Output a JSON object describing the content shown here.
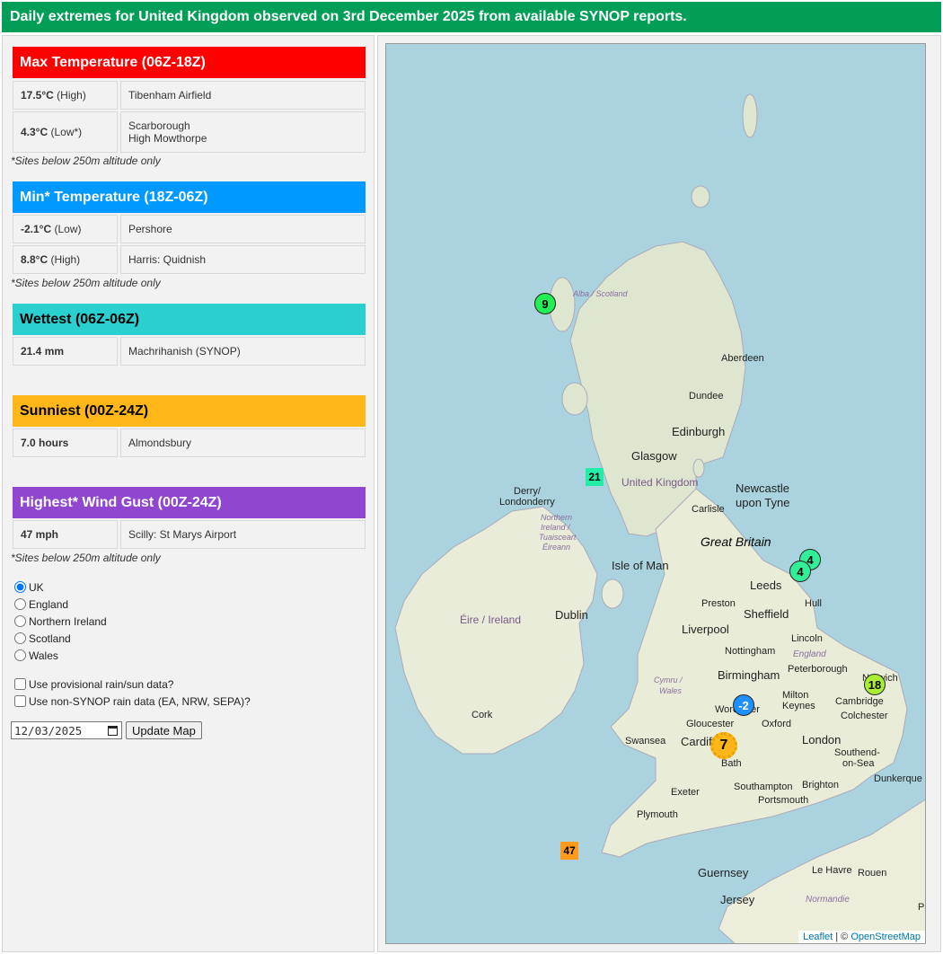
{
  "header": {
    "title": "Daily extremes for United Kingdom observed on 3rd December 2025 from available SYNOP reports."
  },
  "sections": {
    "max_temp": {
      "title": "Max Temperature (06Z-18Z)",
      "color": "#ff0000",
      "rows": [
        {
          "value": "17.5°C",
          "qual": "(High)",
          "site": "Tibenham Airfield"
        },
        {
          "value": "4.3°C",
          "qual": "(Low*)",
          "site": "Scarborough",
          "site2": "High Mowthorpe"
        }
      ],
      "note": "*Sites below 250m altitude only"
    },
    "min_temp": {
      "title": "Min* Temperature (18Z-06Z)",
      "color": "#0099ff",
      "rows": [
        {
          "value": "-2.1°C",
          "qual": "(Low)",
          "site": "Pershore"
        },
        {
          "value": "8.8°C",
          "qual": "(High)",
          "site": "Harris: Quidnish"
        }
      ],
      "note": "*Sites below 250m altitude only"
    },
    "wettest": {
      "title": "Wettest (06Z-06Z)",
      "color": "#2acfcf",
      "rows": [
        {
          "value": "21.4 mm",
          "site": "Machrihanish (SYNOP)"
        }
      ]
    },
    "sunniest": {
      "title": "Sunniest (00Z-24Z)",
      "color": "#ffb619",
      "rows": [
        {
          "value": "7.0 hours",
          "site": "Almondsbury"
        }
      ]
    },
    "gust": {
      "title": "Highest* Wind Gust (00Z-24Z)",
      "color": "#9046cf",
      "rows": [
        {
          "value": "47 mph",
          "site": "Scilly: St Marys Airport"
        }
      ],
      "note": "*Sites below 250m altitude only"
    }
  },
  "regions": [
    "UK",
    "England",
    "Northern Ireland",
    "Scotland",
    "Wales"
  ],
  "selected_region": "UK",
  "options": {
    "provisional": "Use provisional rain/sun data?",
    "non_synop": "Use non-SYNOP rain data (EA, NRW, SEPA)?"
  },
  "date_value": "12/03/2025",
  "update_button": "Update Map",
  "map": {
    "labels": {
      "alba": "Alba / Scotland",
      "aberdeen": "Aberdeen",
      "dundee": "Dundee",
      "edinburgh": "Edinburgh",
      "glasgow": "Glasgow",
      "uk": "United Kingdom",
      "newcastle1": "Newcastle",
      "newcastle2": "upon Tyne",
      "derry1": "Derry/",
      "derry2": "Londonderry",
      "ni1": "Northern",
      "ni2": "Ireland /",
      "ni3": "Tuaisceart",
      "ni4": "Éireann",
      "carlisle": "Carlisle",
      "gb": "Great Britain",
      "iom": "Isle of Man",
      "leeds": "Leeds",
      "preston": "Preston",
      "hull": "Hull",
      "sheffield": "Sheffield",
      "eire": "Éire / Ireland",
      "dublin": "Dublin",
      "liverpool": "Liverpool",
      "lincoln": "Lincoln",
      "nottingham": "Nottingham",
      "england": "England",
      "peterborough": "Peterborough",
      "cymru1": "Cymru /",
      "cymru2": "Wales",
      "birmingham": "Birmingham",
      "norwich": "Norwich",
      "cambridge": "Cambridge",
      "milton1": "Milton",
      "milton2": "Keynes",
      "cork": "Cork",
      "worcester": "Worcester",
      "colchester": "Colchester",
      "gloucester": "Gloucester",
      "oxford": "Oxford",
      "swansea": "Swansea",
      "cardiff": "Cardiff",
      "london": "London",
      "bath": "Bath",
      "southend1": "Southend-",
      "southend2": "on-Sea",
      "dunkerque": "Dunkerque",
      "exeter": "Exeter",
      "southampton": "Southampton",
      "brighton": "Brighton",
      "portsmouth": "Portsmouth",
      "plymouth": "Plymouth",
      "guernsey": "Guernsey",
      "lehavre": "Le Havre",
      "rouen": "Rouen",
      "jersey": "Jersey",
      "normandie": "Normandie",
      "pa": "Pa"
    },
    "markers": {
      "harris": "9",
      "machrihanish": "21",
      "scarborough": "4",
      "highmowthorpe": "4",
      "tibenham": "18",
      "pershore": "-2",
      "almondsbury": "7",
      "scilly": "47"
    },
    "attribution": {
      "leaflet": "Leaflet",
      "sep": " | © ",
      "osm": "OpenStreetMap"
    }
  }
}
